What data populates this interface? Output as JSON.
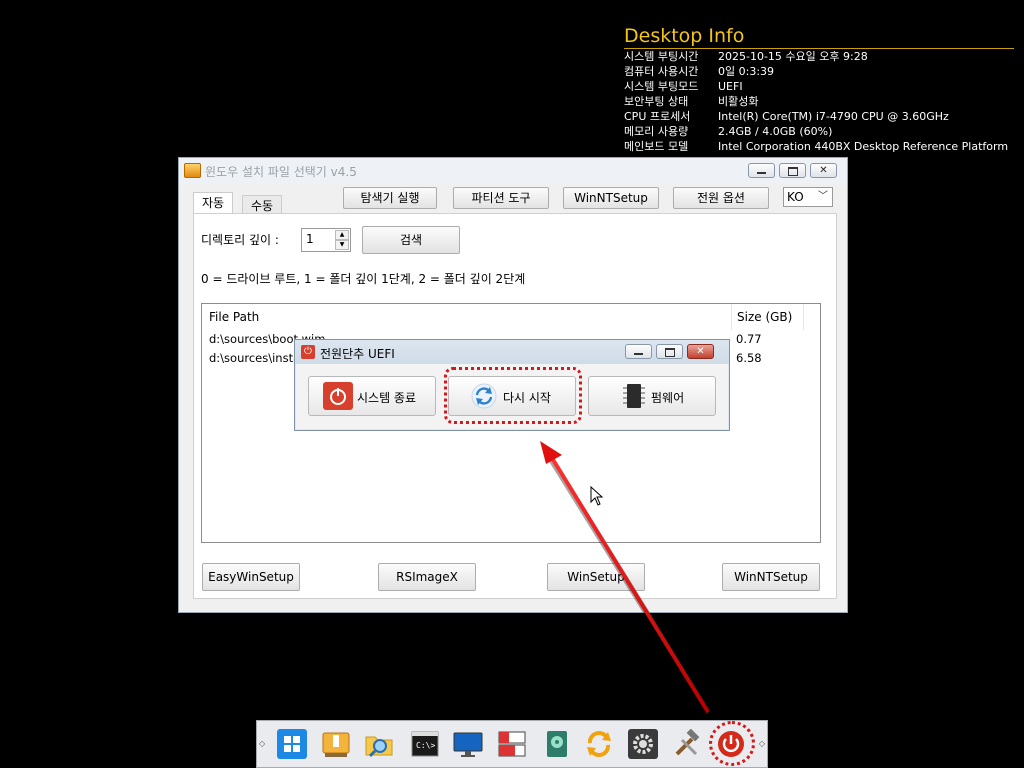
{
  "desktop_info": {
    "title": "Desktop Info",
    "rows": [
      {
        "k": "시스템 부팅시간",
        "v": "2025-10-15 수요일 오후 9:28"
      },
      {
        "k": "컴퓨터 사용시간",
        "v": "0일 0:3:39"
      },
      {
        "k": "시스템 부팅모드",
        "v": "UEFI"
      },
      {
        "k": "보안부팅 상태",
        "v": "비활성화"
      },
      {
        "k": "CPU 프로세서",
        "v": "Intel(R) Core(TM) i7-4790 CPU @ 3.60GHz"
      },
      {
        "k": "메모리 사용량",
        "v": "2.4GB / 4.0GB (60%)"
      },
      {
        "k": "메인보드 모델",
        "v": "Intel Corporation 440BX Desktop Reference Platform"
      }
    ]
  },
  "main_window": {
    "title": "윈도우 설치 파일 선택기 v4.5",
    "tabs": [
      "자동",
      "수동"
    ],
    "toolbar": {
      "explorer": "탐색기 실행",
      "partition": "파티션 도구",
      "winntsetup": "WinNTSetup",
      "power": "전원 옵션",
      "language": "KO"
    },
    "depth_label": "디렉토리 깊이 :",
    "depth_value": "1",
    "search_button": "검색",
    "hint": "0 = 드라이브 루트, 1 = 폴더 깊이 1단계, 2 = 폴더 깊이 2단계",
    "table": {
      "headers": [
        "File Path",
        "Size (GB)"
      ],
      "rows": [
        {
          "path": "d:\\sources\\boot.wim",
          "size": "0.77"
        },
        {
          "path": "d:\\sources\\install.wim",
          "size": "6.58"
        }
      ]
    },
    "bottom_buttons": {
      "easywin": "EasyWinSetup",
      "rsimage": "RSImageX",
      "winsetup": "WinSetup",
      "winnt": "WinNTSetup"
    }
  },
  "power_dialog": {
    "title": "전원단추  UEFI",
    "shutdown": "시스템 종료",
    "restart": "다시 시작",
    "firmware": "펌웨어"
  },
  "colors": {
    "highlight": "#d21a1a",
    "desktop_info_title": "#f5c518"
  },
  "taskbar_icons": [
    "windows-icon",
    "usb-drive-icon",
    "folder-search-icon",
    "cmd-icon",
    "monitor-icon",
    "partition-tool-icon",
    "disk-utility-icon",
    "refresh-sync-icon",
    "settings-gear-icon",
    "tools-icon",
    "power-icon"
  ]
}
